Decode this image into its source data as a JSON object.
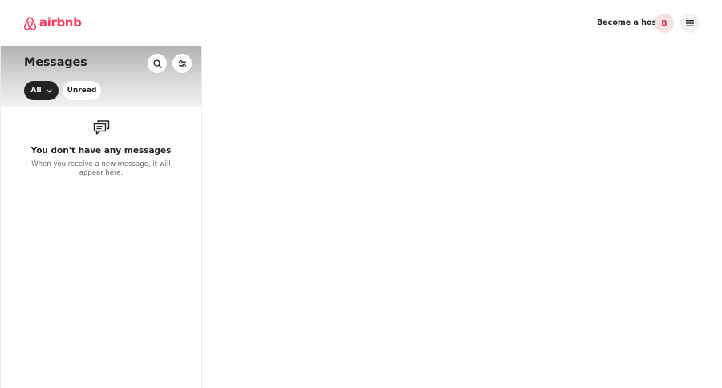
{
  "header": {
    "logo_text": "airbnb",
    "become_host_label": "Become a host",
    "avatar_initial": "B",
    "brand_color": "#ff385c"
  },
  "messages": {
    "title": "Messages",
    "search_icon": "search-icon",
    "settings_icon": "settings-sliders-icon",
    "filters": {
      "all_label": "All",
      "unread_label": "Unread"
    },
    "empty_state": {
      "icon": "chat-bubbles-icon",
      "title": "You don't have any messages",
      "description": "When you receive a new message, it will appear here."
    }
  }
}
